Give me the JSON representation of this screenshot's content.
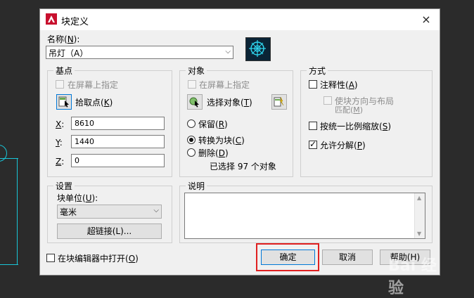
{
  "dialog": {
    "title": "块定义",
    "close": "×"
  },
  "name": {
    "label": "名称(",
    "label_key": "N",
    "label_end": "):",
    "value": "吊灯（A）"
  },
  "base_point": {
    "title": "基点",
    "specify_on_screen": "在屏幕上指定",
    "pick_point": "拾取点(",
    "pick_point_key": "K",
    "pick_point_end": ")",
    "x_label": "X",
    "y_label": "Y",
    "z_label": "Z",
    "colon": ":",
    "x": "8610",
    "y": "1440",
    "z": "0"
  },
  "objects": {
    "title": "对象",
    "specify_on_screen": "在屏幕上指定",
    "select_objects": "选择对象(",
    "select_key": "T",
    "select_end": ")",
    "retain": "保留(",
    "retain_key": "R",
    "convert": "转换为块(",
    "convert_key": "C",
    "delete": "删除(",
    "delete_key": "D",
    "close_paren": ")",
    "selected_count": "已选择 97 个对象"
  },
  "behavior": {
    "title": "方式",
    "annotative": "注释性(",
    "annotative_key": "A",
    "annotative_end": ")",
    "match_orientation_1": "使块方向与布局",
    "match_orientation_2": "匹配(",
    "match_orientation_key": "M",
    "match_orientation_end": ")",
    "scale_uniformly": "按统一比例缩放(",
    "scale_key": "S",
    "scale_end": ")",
    "allow_exploding": "允许分解(",
    "explode_key": "P",
    "explode_end": ")"
  },
  "settings": {
    "title": "设置",
    "block_unit_label": "块单位(",
    "block_unit_key": "U",
    "block_unit_end": "):",
    "block_unit_value": "毫米",
    "hyperlink": "超链接(L)..."
  },
  "description": {
    "title": "说明"
  },
  "footer": {
    "open_in_editor": "在块编辑器中打开(",
    "open_key": "O",
    "open_end": ")",
    "ok": "确定",
    "cancel": "取消",
    "help": "帮助(H)"
  },
  "watermark": "Bai 经验",
  "colors": {
    "accent": "#0078d7",
    "highlight": "#e02020",
    "cad_line": "#19c6d8"
  }
}
